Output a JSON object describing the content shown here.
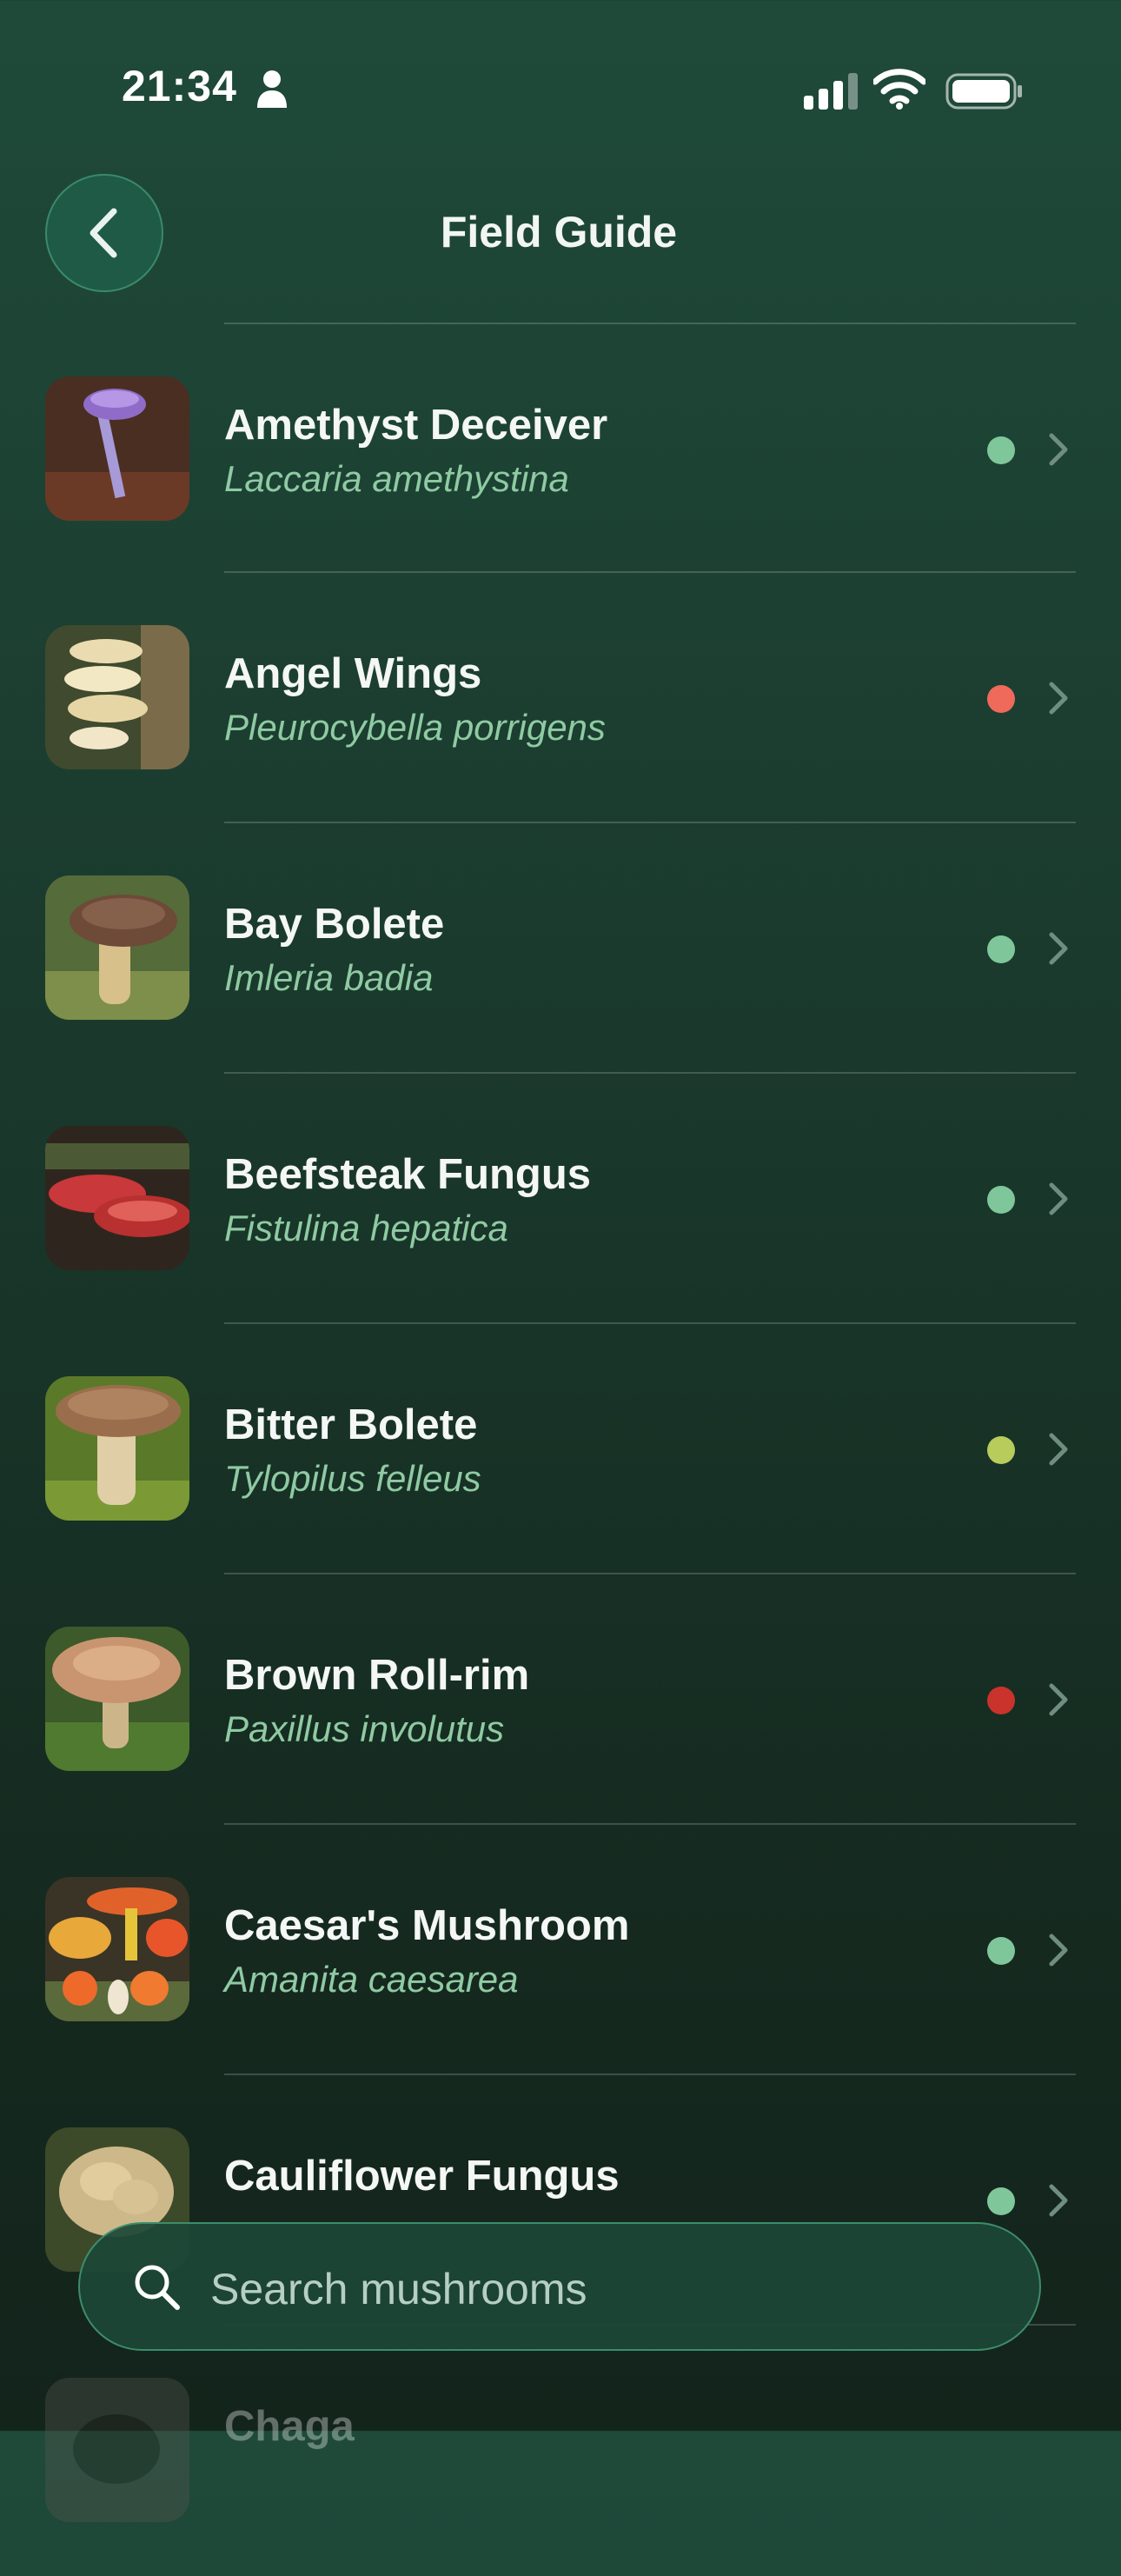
{
  "status_bar": {
    "time": "21:34",
    "icons": [
      "person-icon",
      "signal-icon",
      "wifi-icon",
      "battery-icon"
    ]
  },
  "header": {
    "title": "Field Guide",
    "back_icon": "chevron-left-icon"
  },
  "colors": {
    "edible": "#7fc79a",
    "toxic": "#ef6a5b",
    "caution": "#b8cc5c",
    "deadly": "#c9332c",
    "accent": "#3d8c6b"
  },
  "items": [
    {
      "common": "Amethyst Deceiver",
      "latin": "Laccaria amethystina",
      "status_color": "#7fc79a"
    },
    {
      "common": "Angel Wings",
      "latin": "Pleurocybella porrigens",
      "status_color": "#ef6a5b"
    },
    {
      "common": "Bay Bolete",
      "latin": "Imleria badia",
      "status_color": "#7fc79a"
    },
    {
      "common": "Beefsteak Fungus",
      "latin": "Fistulina hepatica",
      "status_color": "#7fc79a"
    },
    {
      "common": "Bitter Bolete",
      "latin": "Tylopilus felleus",
      "status_color": "#b8cc5c"
    },
    {
      "common": "Brown Roll-rim",
      "latin": "Paxillus involutus",
      "status_color": "#c9332c"
    },
    {
      "common": "Caesar's Mushroom",
      "latin": "Amanita caesarea",
      "status_color": "#7fc79a"
    },
    {
      "common": "Cauliflower Fungus",
      "latin": "",
      "status_color": "#7fc79a"
    },
    {
      "common": "Chaga",
      "latin": "",
      "status_color": ""
    }
  ],
  "search": {
    "placeholder": "Search mushrooms",
    "icon": "search-icon"
  }
}
